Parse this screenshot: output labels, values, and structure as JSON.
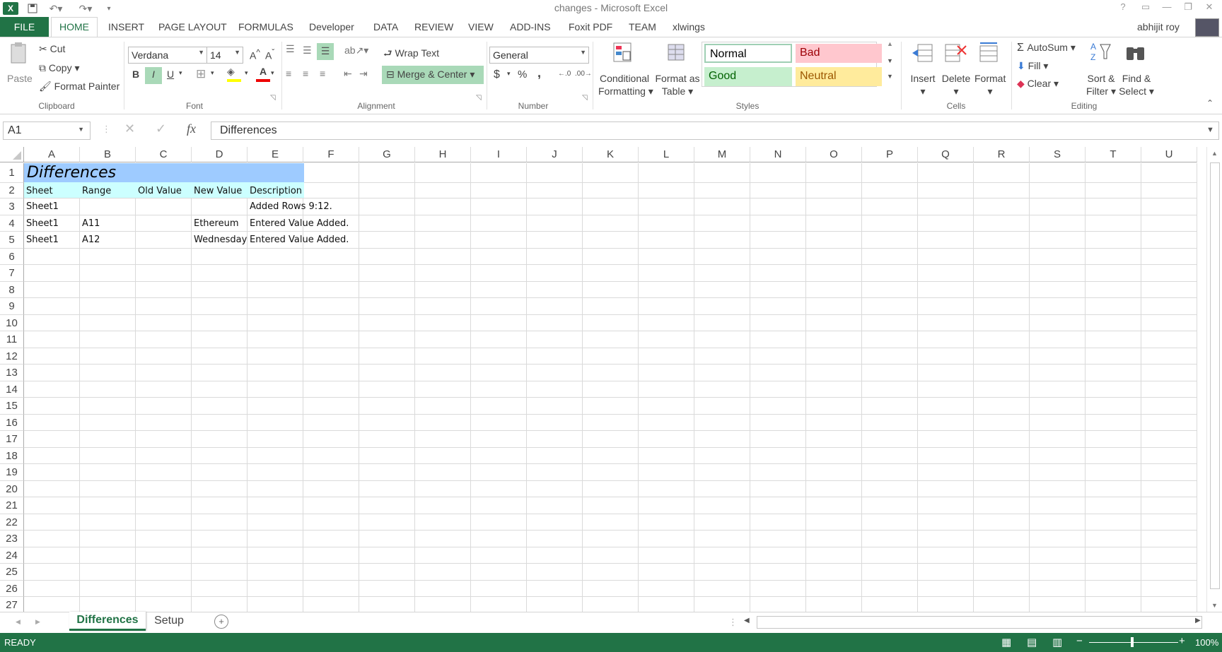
{
  "window": {
    "title": "changes - Microsoft Excel",
    "user": "abhijit roy",
    "help": "?"
  },
  "ribbon_tabs": [
    "FILE",
    "HOME",
    "INSERT",
    "PAGE LAYOUT",
    "FORMULAS",
    "Developer",
    "DATA",
    "REVIEW",
    "VIEW",
    "ADD-INS",
    "Foxit PDF",
    "TEAM",
    "xlwings"
  ],
  "clipboard": {
    "paste": "Paste",
    "cut": "Cut",
    "copy": "Copy",
    "format_painter": "Format Painter",
    "label": "Clipboard"
  },
  "font": {
    "name": "Verdana",
    "size": "14",
    "bold": "B",
    "italic": "I",
    "underline": "U",
    "label": "Font"
  },
  "alignment": {
    "wrap_text": "Wrap Text",
    "merge_center": "Merge & Center",
    "label": "Alignment"
  },
  "number": {
    "format": "General",
    "currency": "$",
    "percent": "%",
    "comma": ",",
    "label": "Number"
  },
  "styles": {
    "conditional": "Conditional",
    "formatting": "Formatting",
    "format_as": "Format as",
    "table": "Table",
    "normal": "Normal",
    "bad": "Bad",
    "good": "Good",
    "neutral": "Neutral",
    "label": "Styles"
  },
  "cells": {
    "insert": "Insert",
    "delete": "Delete",
    "format": "Format",
    "label": "Cells"
  },
  "editing": {
    "autosum": "AutoSum",
    "fill": "Fill",
    "clear": "Clear",
    "sort": "Sort &",
    "filter": "Filter",
    "find": "Find &",
    "select": "Select",
    "label": "Editing"
  },
  "formula_bar": {
    "name_box": "A1",
    "fx": "fx",
    "content": "Differences"
  },
  "columns": [
    "A",
    "B",
    "C",
    "D",
    "E",
    "F",
    "G",
    "H",
    "I",
    "J",
    "K",
    "L",
    "M",
    "N",
    "O",
    "P",
    "Q",
    "R",
    "S",
    "T",
    "U"
  ],
  "rows": [
    "1",
    "2",
    "3",
    "4",
    "5",
    "6",
    "7",
    "8",
    "9",
    "10",
    "11",
    "12",
    "13",
    "14",
    "15",
    "16",
    "17",
    "18",
    "19",
    "20",
    "21",
    "22",
    "23",
    "24",
    "25",
    "26",
    "27"
  ],
  "sheet": {
    "title": "Differences",
    "headers": [
      "Sheet",
      "Range",
      "Old Value",
      "New Value",
      "Description"
    ],
    "rows": [
      [
        "Sheet1",
        "",
        "",
        "",
        "Added Rows 9:12."
      ],
      [
        "Sheet1",
        "A11",
        "",
        "Ethereum",
        "Entered Value Added."
      ],
      [
        "Sheet1",
        "A12",
        "",
        "Wednesday",
        "Entered Value Added."
      ]
    ]
  },
  "sheet_tabs": [
    "Differences",
    "Setup"
  ],
  "status": {
    "ready": "READY",
    "zoom": "100%"
  },
  "colors": {
    "accent": "#217346",
    "title_fill": "#9ecbff",
    "header_fill": "#ccffff"
  }
}
